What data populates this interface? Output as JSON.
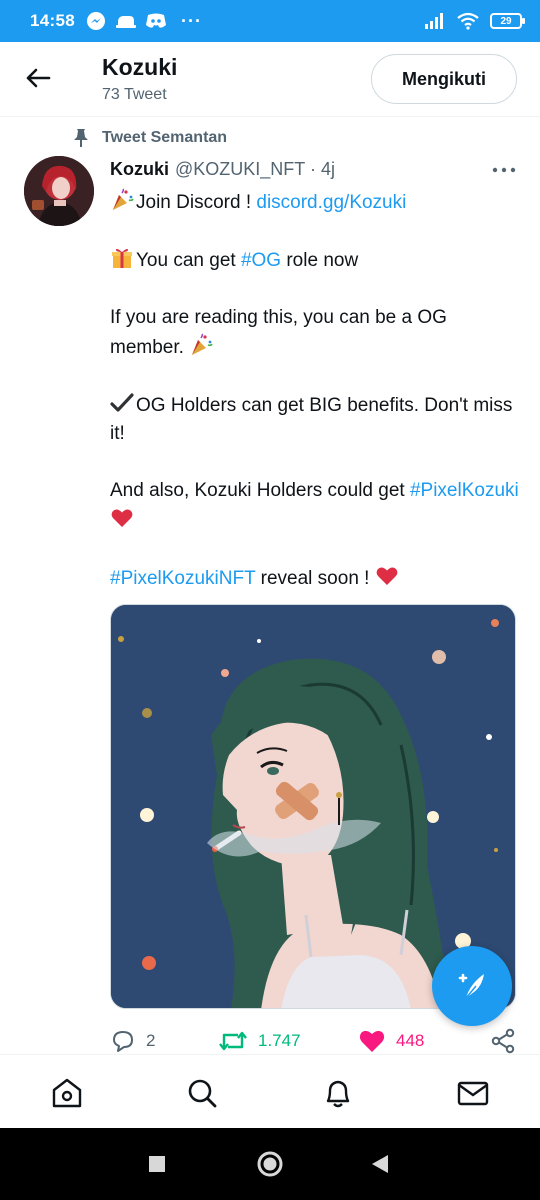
{
  "status_bar": {
    "time": "14:58",
    "more": "···",
    "battery": "29"
  },
  "header": {
    "title": "Kozuki",
    "subtitle": "73 Tweet",
    "follow_label": "Mengikuti"
  },
  "pinned": {
    "label": "Tweet Semantan"
  },
  "tweet": {
    "name": "Kozuki",
    "handle": "@KOZUKI_NFT · 4j",
    "line1_text": "Join Discord ! ",
    "line1_link": "discord.gg/Kozuki",
    "line2_pre": "You can get ",
    "line2_tag": "#OG",
    "line2_post": " role now",
    "line3": "If you are reading this, you can be a OG member.",
    "line4": "OG Holders can get BIG benefits. Don't miss it!",
    "line5_pre": "And also, Kozuki Holders could get ",
    "line5_tag": "#PixelKozuki",
    "line6_tag": "#PixelKozukiNFT",
    "line6_post": " reveal soon !"
  },
  "actions": {
    "replies": "2",
    "retweets": "1.747",
    "likes": "448"
  },
  "colors": {
    "accent": "#1d9bf0",
    "retweet": "#00ba7c",
    "like": "#f91880"
  },
  "icons": {
    "back": "arrow-left-icon",
    "pin": "pin-icon",
    "more": "more-icon",
    "reply": "reply-icon",
    "retweet": "retweet-icon",
    "like": "heart-icon",
    "share": "share-icon",
    "compose": "compose-icon",
    "home": "home-icon",
    "search": "search-icon",
    "notifications": "bell-icon",
    "messages": "mail-icon"
  }
}
